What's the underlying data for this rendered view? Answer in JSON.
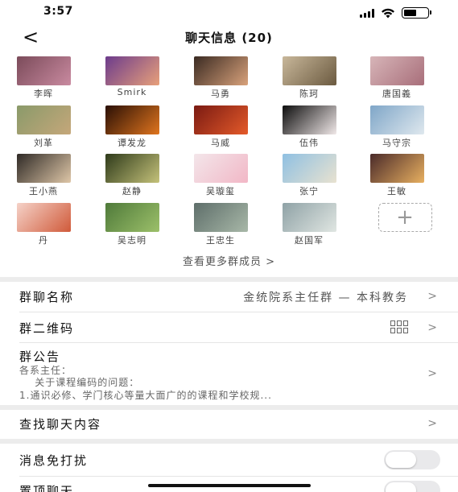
{
  "status": {
    "time": "3:57"
  },
  "nav": {
    "title": "聊天信息 (20)",
    "back_label": "<"
  },
  "members": [
    {
      "name": "李晖",
      "avatar": "cherry-blossom-photo",
      "color_a": "#7b4b5a",
      "color_b": "#c98aa0"
    },
    {
      "name": "Smirk",
      "avatar": "purple-sunset-tree-photo",
      "color_a": "#6c3b8c",
      "color_b": "#e8a07a"
    },
    {
      "name": "马勇",
      "avatar": "child-portrait-photo",
      "color_a": "#3a2a22",
      "color_b": "#d9a27b"
    },
    {
      "name": "陈珂",
      "avatar": "calligraphy-image",
      "color_a": "#c8b79a",
      "color_b": "#6b5a40"
    },
    {
      "name": "唐国義",
      "avatar": "pink-flower-photo",
      "color_a": "#d7b5b8",
      "color_b": "#a86e7a"
    },
    {
      "name": "刘革",
      "avatar": "giraffe-photo",
      "color_a": "#8a9a6a",
      "color_b": "#c5a77a"
    },
    {
      "name": "谭发龙",
      "avatar": "fire-dragon-photo",
      "color_a": "#2a0f05",
      "color_b": "#e0751e"
    },
    {
      "name": "马威",
      "avatar": "red-autumn-leaves-photo",
      "color_a": "#7a1a12",
      "color_b": "#e45a2a"
    },
    {
      "name": "伍伟",
      "avatar": "white-flowers-dark-photo",
      "color_a": "#0d0d0d",
      "color_b": "#f0e8e8"
    },
    {
      "name": "马守宗",
      "avatar": "lake-sky-photo",
      "color_a": "#7fa6c8",
      "color_b": "#dfe8ee"
    },
    {
      "name": "王小燕",
      "avatar": "child-cap-photo",
      "color_a": "#2f2a26",
      "color_b": "#dfc7a8"
    },
    {
      "name": "赵静",
      "avatar": "forest-path-photo",
      "color_a": "#2e3a1a",
      "color_b": "#c5c27a"
    },
    {
      "name": "吴璇玺",
      "avatar": "cartoon-girl-image",
      "color_a": "#f3e6ea",
      "color_b": "#f2b7c6"
    },
    {
      "name": "张宁",
      "avatar": "man-beach-photo",
      "color_a": "#8fc0e2",
      "color_b": "#e8e2d0"
    },
    {
      "name": "王敏",
      "avatar": "woman-portrait-photo",
      "color_a": "#4a2a2a",
      "color_b": "#e8b060"
    },
    {
      "name": "丹",
      "avatar": "anime-girl-image",
      "color_a": "#f5d2c8",
      "color_b": "#d05a3a"
    },
    {
      "name": "吴志明",
      "avatar": "statue-lawn-photo",
      "color_a": "#4f7a3a",
      "color_b": "#9cc06a"
    },
    {
      "name": "王忠生",
      "avatar": "lake-trees-photo",
      "color_a": "#5e6e6a",
      "color_b": "#a8b8a8"
    },
    {
      "name": "赵国军",
      "avatar": "winter-river-photo",
      "color_a": "#8fa2a6",
      "color_b": "#e0e6e2"
    }
  ],
  "add_member": {
    "icon": "plus-icon",
    "glyph": "+"
  },
  "more_members": "查看更多群成员 >",
  "group_name": {
    "label": "群聊名称",
    "value": "金统院系主任群 — 本科教务"
  },
  "qr_code": {
    "label": "群二维码",
    "icon": "qr-code-icon"
  },
  "notice": {
    "label": "群公告",
    "lines": [
      "各系主任：",
      "    关于课程编码的问题：",
      "1.通识必修、学门核心等量大面广的的课程和学校规..."
    ]
  },
  "search_chat": {
    "label": "查找聊天内容"
  },
  "do_not_disturb": {
    "label": "消息免打扰",
    "enabled": false
  },
  "pin_chat": {
    "label": "置顶聊天",
    "enabled": false
  },
  "chevron": ">",
  "colors": {
    "divider": "#ececec",
    "toggle_off": "#e9e9eb"
  }
}
